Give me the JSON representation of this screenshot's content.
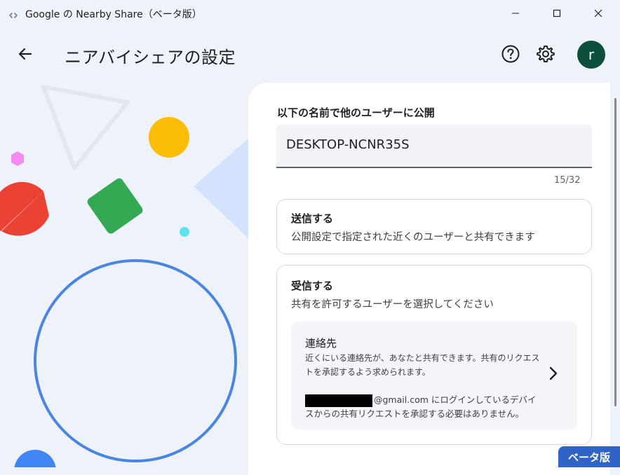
{
  "window": {
    "title": "Google の Nearby Share（ベータ版）",
    "controls": {
      "minimize_icon": "minimize-icon",
      "maximize_icon": "maximize-icon",
      "close_icon": "close-icon"
    }
  },
  "header": {
    "title": "ニアバイシェアの設定",
    "avatar_letter": "r",
    "icons": {
      "back": "arrow-left-icon",
      "help": "help-circle-icon",
      "settings": "gear-icon"
    }
  },
  "device_name": {
    "label": "以下の名前で他のユーザーに公開",
    "value": "DESKTOP-NCNR35S",
    "char_count": "15/32"
  },
  "send": {
    "title": "送信する",
    "description": "公開設定で指定された近くのユーザーと共有できます"
  },
  "receive": {
    "title": "受信する",
    "description": "共有を許可するユーザーを選択してください",
    "contacts": {
      "title": "連絡先",
      "description": "近くにいる連絡先が、あなたと共有できます。共有のリクエストを承認するよう求められます。",
      "note_email_suffix": "@gmail.com にログインしているデバイスからの共有リクエストを承認する必要はありません。"
    }
  },
  "badge": {
    "label": "ベータ版"
  },
  "colors": {
    "background": "#eef3fb",
    "avatar": "#0b4f3c",
    "badge": "#2f63c6",
    "circle_outline": "#4a86e0",
    "yellow_circle": "#fbbc04",
    "green_square": "#34a853",
    "red_semicircle": "#ea4335"
  }
}
